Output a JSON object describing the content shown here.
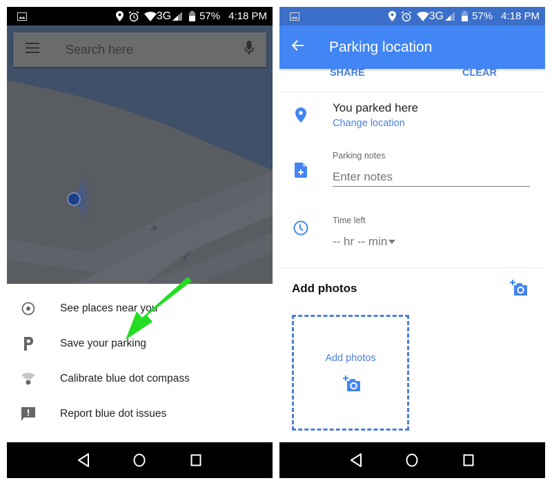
{
  "status_bar": {
    "time": "4:18 PM",
    "battery": "57%",
    "network": "3G",
    "icons": [
      "gallery-icon",
      "location-icon",
      "alarm-icon",
      "wifi-icon",
      "signal-icon",
      "battery-icon"
    ]
  },
  "left_screen": {
    "search": {
      "placeholder": "Search here",
      "menu_icon": "hamburger-menu-icon",
      "voice_icon": "microphone-icon"
    },
    "menu_items": [
      {
        "label": "See places near you",
        "icon": "target-icon"
      },
      {
        "label": "Save your parking",
        "icon": "parking-icon"
      },
      {
        "label": "Calibrate blue dot compass",
        "icon": "compass-calibrate-icon"
      },
      {
        "label": "Report blue dot issues",
        "icon": "feedback-icon"
      }
    ],
    "annotation": {
      "type": "arrow",
      "color": "#22dd22",
      "points_to": "Save your parking"
    }
  },
  "right_screen": {
    "app_bar": {
      "title": "Parking location",
      "back_icon": "arrow-back-icon"
    },
    "actions": {
      "share": "SHARE",
      "clear": "CLEAR"
    },
    "location": {
      "title": "You parked here",
      "link": "Change location"
    },
    "notes": {
      "label": "Parking notes",
      "placeholder": "Enter notes",
      "value": ""
    },
    "time_left": {
      "label": "Time left",
      "value": "-- hr -- min"
    },
    "photos": {
      "title": "Add photos",
      "drop_label": "Add photos"
    }
  },
  "nav_bar": {
    "buttons": [
      "back",
      "home",
      "recents"
    ]
  },
  "colors": {
    "accent": "#4285f4",
    "status_bar_blue": "#3b6fc9",
    "link_blue": "#4a7fd8",
    "annotation_green": "#22dd22"
  }
}
